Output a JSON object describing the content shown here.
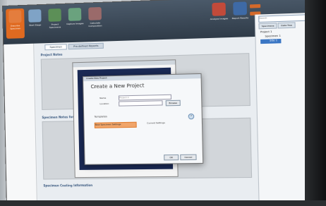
{
  "ribbon": {
    "buttons": [
      {
        "label": "Describe Specimen",
        "active": true
      },
      {
        "label": "Start Stage",
        "active": false
      },
      {
        "label": "Project Specimens",
        "active": false
      },
      {
        "label": "Capture Images",
        "active": false
      },
      {
        "label": "Calculate Composition",
        "active": false
      }
    ],
    "right_buttons": [
      {
        "label": "Analyze Images"
      },
      {
        "label": "Report Results"
      }
    ]
  },
  "content": {
    "tabs": [
      "Specimen",
      "Pre-defined Reports"
    ],
    "sections": [
      "Project Notes",
      "Specimen Notes for: Specimen 1",
      "Specimen Coating Information"
    ]
  },
  "right_pane": {
    "search_placeholder": "Search",
    "tabs": [
      "Specimens",
      "Data Tree"
    ],
    "tree": [
      "Project 1",
      "Specimen 1",
      "Site 1"
    ]
  },
  "dialog": {
    "title_bar": "Create New Project",
    "heading": "Create a New Project",
    "name_label": "Name",
    "name_value": "Project 2",
    "location_label": "Location",
    "browse_label": "Browse",
    "templates_label": "Templates",
    "template_selected": "New Specimen Settings",
    "current_settings_label": "Current Settings",
    "ok_label": "OK",
    "cancel_label": "Cancel"
  },
  "colors": {
    "accent": "#e06a20",
    "ribbon": "#3a4654",
    "selection": "#3a76c4"
  }
}
